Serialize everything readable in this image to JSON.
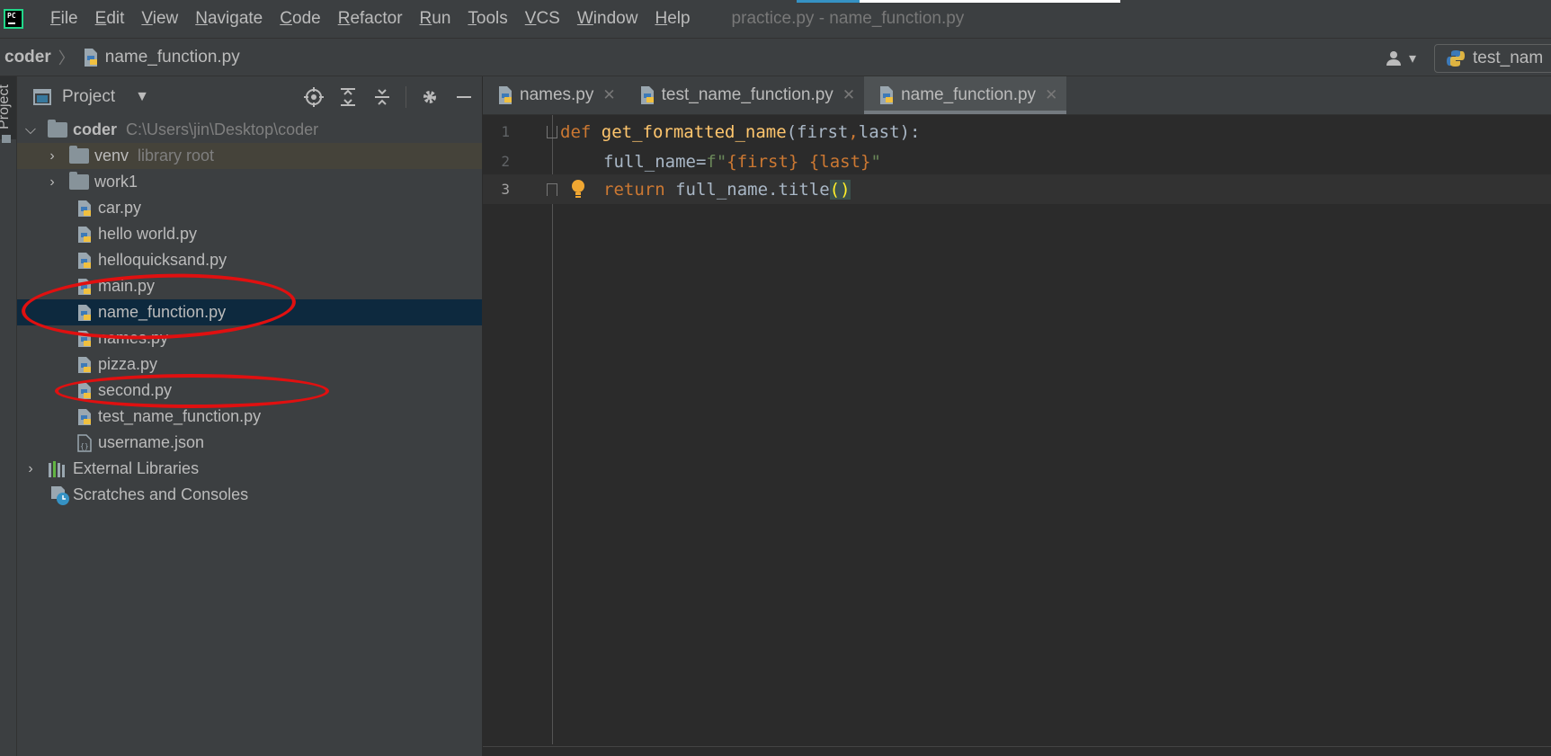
{
  "app": {
    "logo_text": "PC",
    "window_title": "practice.py - name_function.py"
  },
  "menu": [
    {
      "label": "File",
      "mnemonic": "F",
      "rest": "ile"
    },
    {
      "label": "Edit",
      "mnemonic": "E",
      "rest": "dit"
    },
    {
      "label": "View",
      "mnemonic": "V",
      "rest": "iew"
    },
    {
      "label": "Navigate",
      "mnemonic": "N",
      "rest": "avigate"
    },
    {
      "label": "Code",
      "mnemonic": "C",
      "rest": "ode"
    },
    {
      "label": "Refactor",
      "mnemonic": "R",
      "rest": "efactor"
    },
    {
      "label": "Run",
      "mnemonic": "R",
      "rest": "un"
    },
    {
      "label": "Tools",
      "mnemonic": "T",
      "rest": "ools"
    },
    {
      "label": "VCS",
      "mnemonic": "V",
      "rest": "CS"
    },
    {
      "label": "Window",
      "mnemonic": "W",
      "rest": "indow"
    },
    {
      "label": "Help",
      "mnemonic": "H",
      "rest": "elp"
    }
  ],
  "breadcrumb": {
    "root": "coder",
    "file": "name_function.py"
  },
  "run_config": {
    "label": "test_nam"
  },
  "side_tab": {
    "label": "Project"
  },
  "project_panel": {
    "title": "Project",
    "tree": [
      {
        "label": "coder",
        "sub": "C:\\Users\\jin\\Desktop\\coder"
      },
      {
        "label": "venv",
        "sub": "library root"
      },
      {
        "label": "work1"
      },
      {
        "label": "car.py"
      },
      {
        "label": "hello world.py"
      },
      {
        "label": "helloquicksand.py"
      },
      {
        "label": "main.py"
      },
      {
        "label": "name_function.py"
      },
      {
        "label": "names.py"
      },
      {
        "label": "pizza.py"
      },
      {
        "label": "second.py"
      },
      {
        "label": "test_name_function.py"
      },
      {
        "label": "username.json"
      },
      {
        "label": "External Libraries"
      },
      {
        "label": "Scratches and Consoles"
      }
    ]
  },
  "editor_tabs": [
    {
      "label": "names.py",
      "active": false
    },
    {
      "label": "test_name_function.py",
      "active": false
    },
    {
      "label": "name_function.py",
      "active": true
    }
  ],
  "code_lines": [
    {
      "number": "1",
      "tokens": [
        "def",
        " ",
        "get_formatted_name",
        "(first",
        ",",
        "last):"
      ]
    },
    {
      "number": "2",
      "tokens": [
        "full_name",
        "=",
        "f\"",
        "{first}",
        " ",
        "{last}",
        "\""
      ]
    },
    {
      "number": "3",
      "tokens": [
        "return",
        " full_name.title",
        "(",
        ")"
      ]
    }
  ],
  "colors": {
    "keyword": "#cc7832",
    "function": "#ffc66d",
    "string": "#6a8759",
    "annotation_circle": "#e01010"
  }
}
